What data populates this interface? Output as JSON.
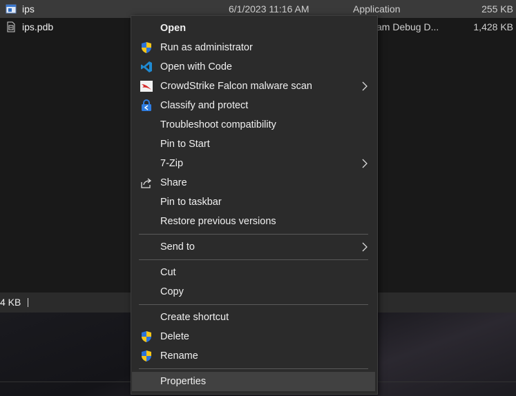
{
  "files": [
    {
      "name": "ips",
      "date": "6/1/2023 11:16 AM",
      "type": "Application",
      "size": "255 KB",
      "icon": "application-icon"
    },
    {
      "name": "ips.pdb",
      "date": "",
      "type": "am Debug D...",
      "size": "1,428 KB",
      "icon": "pdb-file-icon"
    }
  ],
  "status_bar": {
    "selected_size": "4 KB"
  },
  "menu": {
    "open": "Open",
    "run_as_admin": "Run as administrator",
    "open_with_code": "Open with Code",
    "crowdstrike": "CrowdStrike Falcon malware scan",
    "classify": "Classify and protect",
    "troubleshoot": "Troubleshoot compatibility",
    "pin_start": "Pin to Start",
    "seven_zip": "7-Zip",
    "share": "Share",
    "pin_taskbar": "Pin to taskbar",
    "restore": "Restore previous versions",
    "send_to": "Send to",
    "cut": "Cut",
    "copy": "Copy",
    "create_shortcut": "Create shortcut",
    "delete": "Delete",
    "rename": "Rename",
    "properties": "Properties"
  },
  "colors": {
    "menu_bg": "#2b2b2b",
    "hover": "#414141",
    "shield_blue": "#2a72d8",
    "shield_yellow": "#f5c518",
    "vscode_blue": "#1f8ad2",
    "crowdstrike_red": "#d62a2a"
  }
}
